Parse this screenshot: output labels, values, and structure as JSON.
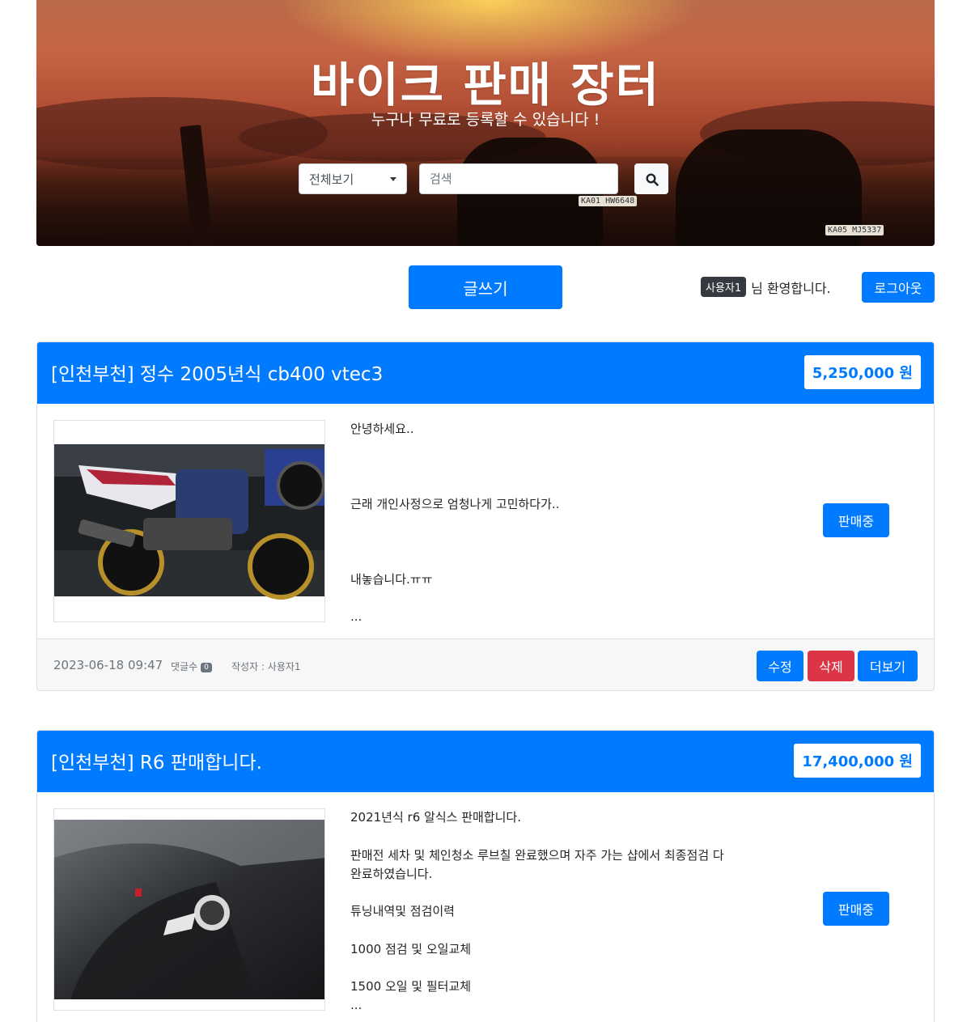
{
  "hero": {
    "title": "바이크 판매 장터",
    "subtitle": "누구나 무료로 등록할 수 있습니다 !",
    "plate_1": "KA01 HW6648",
    "plate_2": "KA05 MJ5337"
  },
  "search": {
    "category_selected": "전체보기",
    "placeholder": "검색",
    "button_icon": "search-icon"
  },
  "toolbar": {
    "write_label": "글쓰기",
    "user_badge": "사용자1",
    "welcome_text": "님 환영합니다.",
    "logout_label": "로그아웃"
  },
  "colors": {
    "primary": "#007bff",
    "danger": "#dc3545",
    "dark": "#343a40",
    "secondary": "#6c757d"
  },
  "posts": [
    {
      "title": "[인천부천] 정수 2005년식 cb400 vtec3",
      "price": "5,250,000 원",
      "desc": [
        "안녕하세요..",
        "근래 개인사정으로 엄청나게 고민하다가..",
        "내놓습니다.ㅠㅠ",
        "..."
      ],
      "status": "판매중",
      "date": "2023-06-18 09:47",
      "comments_label": "댓글수",
      "comments_count": "0",
      "author": "작성자 : 사용자1",
      "edit_label": "수정",
      "delete_label": "삭제",
      "more_label": "더보기"
    },
    {
      "title": "[인천부천] R6 판매합니다.",
      "price": "17,400,000 원",
      "desc": [
        "2021년식 r6 알식스 판매합니다.",
        "판매전 세차 및 체인청소 루브칠 완료했으며 자주 가는 샵에서 최종점검 다",
        "완료하였습니다.",
        "튜닝내역및 점검이력",
        "1000 점검 및 오일교체",
        "1500 오일 및 필터교체",
        "..."
      ],
      "status": "판매중"
    }
  ]
}
